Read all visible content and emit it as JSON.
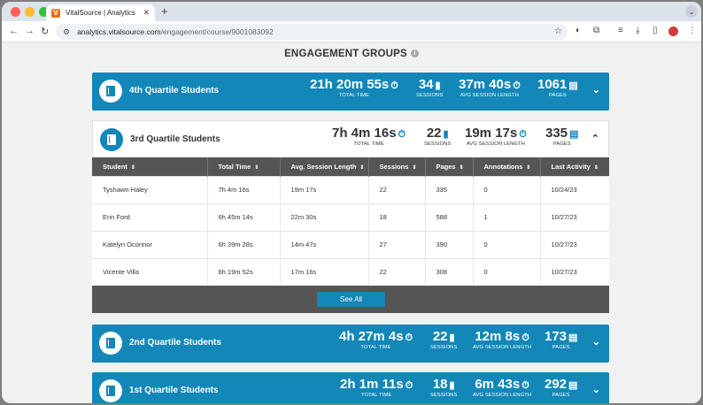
{
  "browser": {
    "tab_title": "VitalSource | Analytics",
    "tab_favicon": "V",
    "url_host": "analytics.vitalsource.com",
    "url_path": "/engagement/course/9001083092"
  },
  "page": {
    "title": "ENGAGEMENT GROUPS"
  },
  "labels": {
    "total_time": "TOTAL TIME",
    "sessions": "SESSIONS",
    "avg": "AVG SESSION LENGTH",
    "pages": "PAGES"
  },
  "groups": [
    {
      "name": "4th Quartile Students",
      "total_time": "21h 20m 55s",
      "sessions": "34",
      "avg": "37m 40s",
      "pages": "1061"
    },
    {
      "name": "3rd Quartile Students",
      "total_time": "7h 4m 16s",
      "sessions": "22",
      "avg": "19m 17s",
      "pages": "335"
    },
    {
      "name": "2nd Quartile Students",
      "total_time": "4h 27m 4s",
      "sessions": "22",
      "avg": "12m 8s",
      "pages": "173"
    },
    {
      "name": "1st Quartile Students",
      "total_time": "2h 1m 11s",
      "sessions": "18",
      "avg": "6m 43s",
      "pages": "292"
    }
  ],
  "table": {
    "headers": [
      "Student",
      "Total Time",
      "Avg. Session Length",
      "Sessions",
      "Pages",
      "Annotations",
      "Last Activity"
    ],
    "rows": [
      [
        "Tyshawn Haley",
        "7h 4m 16s",
        "19m 17s",
        "22",
        "335",
        "0",
        "10/24/23"
      ],
      [
        "Erin Ford",
        "6h 45m 14s",
        "22m 30s",
        "18",
        "588",
        "1",
        "10/27/23"
      ],
      [
        "Katelyn Oconnor",
        "6h 39m 28s",
        "14m 47s",
        "27",
        "390",
        "0",
        "10/27/23"
      ],
      [
        "Vicente Villa",
        "6h 19m 52s",
        "17m 16s",
        "22",
        "308",
        "0",
        "10/27/23"
      ]
    ],
    "see_all": "See All"
  },
  "colors": {
    "accent": "#1287b8",
    "table_header": "#555555"
  }
}
